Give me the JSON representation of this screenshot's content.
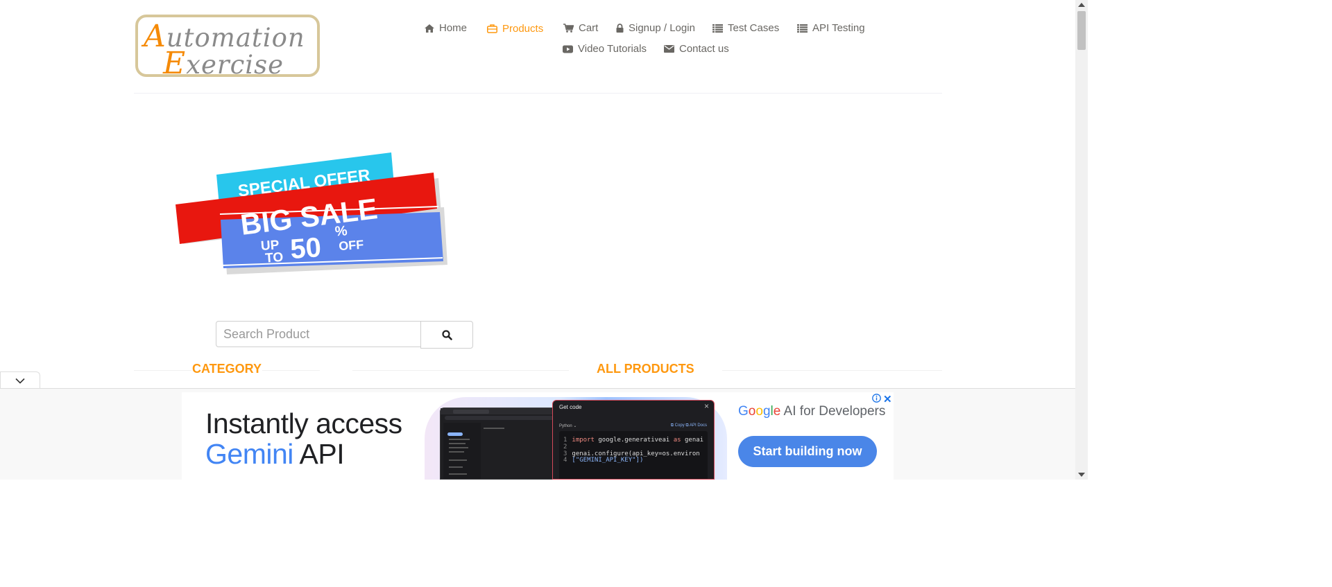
{
  "logo": {
    "line1_cap": "A",
    "line1_rest": "utomation",
    "line2_cap": "E",
    "line2_rest": "xercise"
  },
  "nav": {
    "items": [
      {
        "label": "Home",
        "icon": "home-icon"
      },
      {
        "label": "Products",
        "icon": "briefcase-icon",
        "active": true
      },
      {
        "label": "Cart",
        "icon": "cart-icon"
      },
      {
        "label": "Signup / Login",
        "icon": "lock-icon"
      },
      {
        "label": "Test Cases",
        "icon": "list-icon"
      },
      {
        "label": "API Testing",
        "icon": "list-icon"
      },
      {
        "label": "Video Tutorials",
        "icon": "youtube-play-icon"
      },
      {
        "label": "Contact us",
        "icon": "envelope-icon"
      }
    ]
  },
  "banner": {
    "line1": "SPECIAL OFFER",
    "line2": "BIG SALE",
    "up": "UP",
    "to": "TO",
    "value": "50",
    "percent": "%",
    "off": "OFF"
  },
  "search": {
    "placeholder": "Search Product",
    "button_icon": "search-icon"
  },
  "sections": {
    "category": "CATEGORY",
    "all_products": "ALL PRODUCTS"
  },
  "ad": {
    "headline_line1": "Instantly access",
    "headline_gemini": "Gemini",
    "headline_api": " API",
    "code_title": "Get code",
    "code_lang": "Python ⌄",
    "code_actions": "⧉ Copy    ⧉ API Docs",
    "code_lines": [
      {
        "n": "1",
        "kw": "import",
        "a": " google.generativeai ",
        "kw2": "as",
        "b": " genai"
      },
      {
        "n": "2",
        "kw": "",
        "a": "",
        "kw2": "",
        "b": ""
      },
      {
        "n": "3",
        "kw": "",
        "a": "genai.configure(api_key=os.environ",
        "kw2": "",
        "b": ""
      },
      {
        "n": "4",
        "kw": "",
        "a": "",
        "kw2": "",
        "b": "[\"GEMINI_API_KEY\"])"
      }
    ],
    "brand_suffix": " AI for Developers",
    "cta": "Start building now",
    "colors": {
      "cta": "#4a86e8",
      "gemini_blue": "#4285f4"
    }
  },
  "theme": {
    "accent": "#fe980f",
    "text": "#696763"
  }
}
